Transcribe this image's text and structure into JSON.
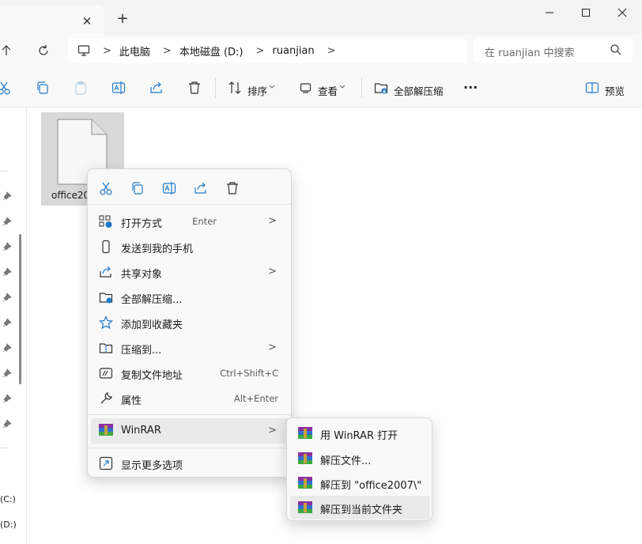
{
  "tab": {
    "close_glyph": "✕",
    "new_tab_glyph": "+"
  },
  "window_controls": {
    "minimize": "—",
    "maximize": "☐",
    "close": "✕"
  },
  "address": {
    "breadcrumbs": [
      "此电脑",
      "本地磁盘 (D:)",
      "ruanjian"
    ],
    "separator": ">",
    "search_placeholder": "在 ruanjian 中搜索"
  },
  "toolbar": {
    "sort_label": "排序",
    "view_label": "查看",
    "extract_all_label": "全部解压缩",
    "more_label": "···",
    "preview_label": "预览"
  },
  "navpane": {
    "drive_c": "(C:)",
    "drive_d": "(D:)"
  },
  "file": {
    "name": "office20"
  },
  "context_menu": {
    "items": [
      {
        "label": "打开方式",
        "shortcut": "Enter",
        "has_submenu": true
      },
      {
        "label": "发送到我的手机",
        "shortcut": "",
        "has_submenu": false
      },
      {
        "label": "共享对象",
        "shortcut": "",
        "has_submenu": true
      },
      {
        "label": "全部解压缩...",
        "shortcut": "",
        "has_submenu": false
      },
      {
        "label": "添加到收藏夹",
        "shortcut": "",
        "has_submenu": false
      },
      {
        "label": "压缩到...",
        "shortcut": "",
        "has_submenu": true
      },
      {
        "label": "复制文件地址",
        "shortcut": "Ctrl+Shift+C",
        "has_submenu": false
      },
      {
        "label": "属性",
        "shortcut": "Alt+Enter",
        "has_submenu": false
      },
      {
        "label": "WinRAR",
        "shortcut": "",
        "has_submenu": true
      },
      {
        "label": "显示更多选项",
        "shortcut": "",
        "has_submenu": false
      }
    ],
    "arrow_glyph": ">"
  },
  "winrar_submenu": {
    "items": [
      {
        "label": "用 WinRAR 打开"
      },
      {
        "label": "解压文件..."
      },
      {
        "label": "解压到 \"office2007\\\""
      },
      {
        "label": "解压到当前文件夹"
      }
    ]
  },
  "colors": {
    "accent": "#0067c0",
    "selection": "#d9d9d9",
    "menu_bg": "#f9f9f9"
  }
}
